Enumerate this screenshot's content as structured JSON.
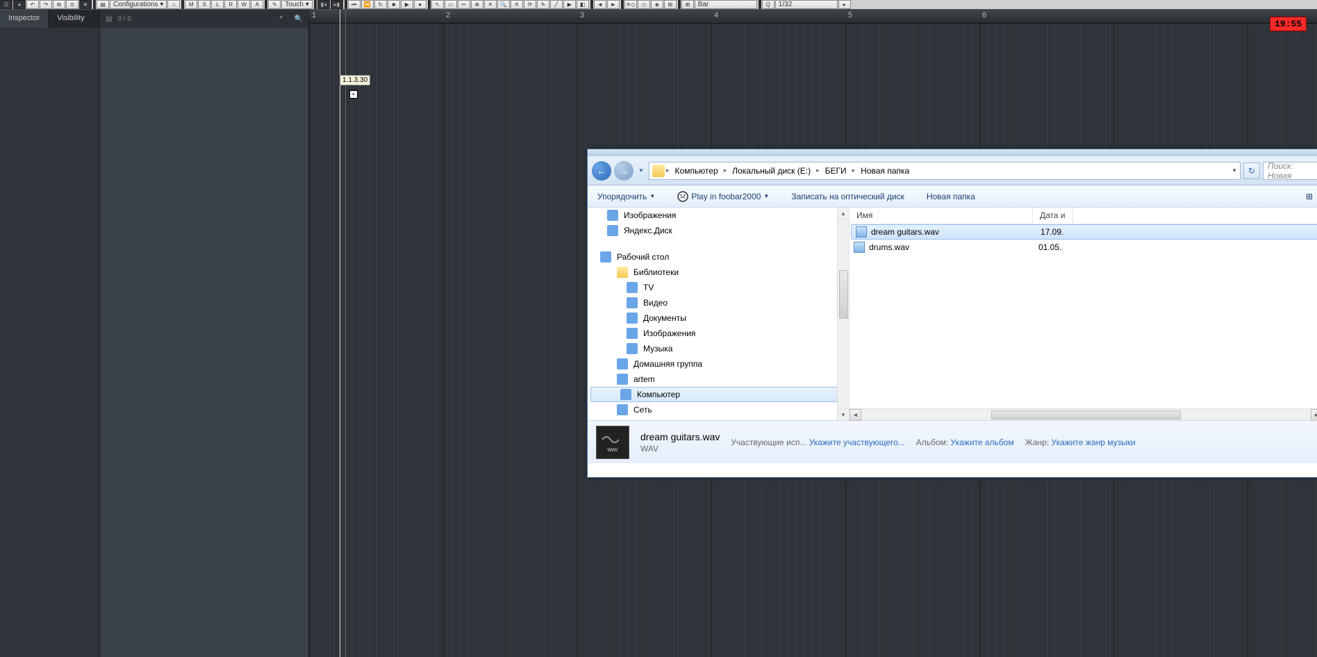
{
  "toolbar": {
    "config_label": "Configurations",
    "automation_label": "Touch",
    "snap_label": "Bar",
    "quantize_label": "1/32",
    "buttons": [
      "M",
      "S",
      "L",
      "R",
      "W",
      "A"
    ]
  },
  "sidebar": {
    "tab_inspector": "Inspector",
    "tab_visibility": "Visibility",
    "track_count": "0 / 0"
  },
  "arrange": {
    "bars": [
      "1",
      "2",
      "3",
      "4",
      "5",
      "6"
    ],
    "timecode": "19:55",
    "position_tip": "1.1.3.30"
  },
  "explorer": {
    "breadcrumb": [
      "Компьютер",
      "Локальный диск (E:)",
      "БЕГИ",
      "Новая папка"
    ],
    "search_placeholder": "Поиск: Новая",
    "toolbar": {
      "organize": "Упорядочить",
      "play": "Play in foobar2000",
      "burn": "Записать на оптический диск",
      "newfolder": "Новая папка"
    },
    "tree": [
      {
        "label": "Изображения",
        "indent": 0,
        "icon": "pic"
      },
      {
        "label": "Яндекс.Диск",
        "indent": 0,
        "icon": "cloud"
      },
      {
        "label": "",
        "spacer": true
      },
      {
        "label": "Рабочий стол",
        "indent": 0,
        "icon": "desk",
        "root": true
      },
      {
        "label": "Библиотеки",
        "indent": 1,
        "icon": "lib"
      },
      {
        "label": "TV",
        "indent": 2,
        "icon": "tv"
      },
      {
        "label": "Видео",
        "indent": 2,
        "icon": "vid"
      },
      {
        "label": "Документы",
        "indent": 2,
        "icon": "doc"
      },
      {
        "label": "Изображения",
        "indent": 2,
        "icon": "pic"
      },
      {
        "label": "Музыка",
        "indent": 2,
        "icon": "mus"
      },
      {
        "label": "Домашняя группа",
        "indent": 1,
        "icon": "hg"
      },
      {
        "label": "artem",
        "indent": 1,
        "icon": "usr"
      },
      {
        "label": "Компьютер",
        "indent": 1,
        "icon": "pc",
        "selected": true
      },
      {
        "label": "Сеть",
        "indent": 1,
        "icon": "net"
      }
    ],
    "list": {
      "col_name": "Имя",
      "col_date": "Дата и",
      "rows": [
        {
          "name": "dream guitars.wav",
          "date": "17.09.",
          "selected": true
        },
        {
          "name": "drums.wav",
          "date": "01.05."
        }
      ]
    },
    "details": {
      "name": "dream guitars.wav",
      "type": "WAV",
      "artists_lbl": "Участвующие исп...",
      "artists_val": "Укажите участвующего...",
      "album_lbl": "Альбом:",
      "album_val": "Укажите альбом",
      "genre_lbl": "Жанр:",
      "genre_val": "Укажите жанр музыки"
    }
  }
}
